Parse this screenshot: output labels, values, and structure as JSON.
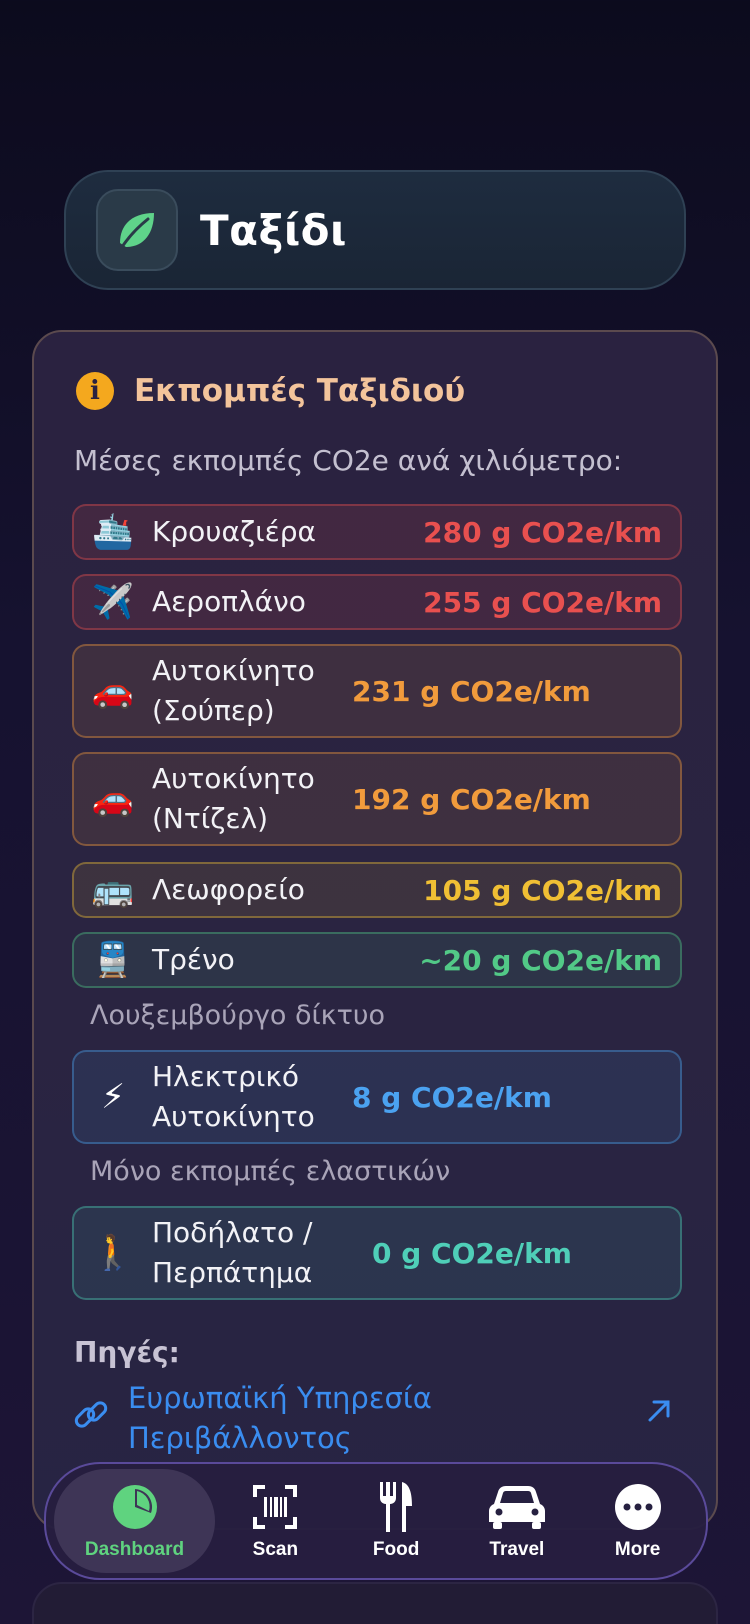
{
  "header": {
    "title": "Ταξίδι",
    "icon": "leaf-icon"
  },
  "card": {
    "title": "Εκπομπές Ταξιδιού",
    "subtitle": "Μέσες εκπομπές CO2e ανά χιλιόμετρο:",
    "rows": [
      {
        "emoji": "🛳️",
        "label": "Κρουαζιέρα",
        "value": "280 g CO2e/km",
        "color": "#e8504f"
      },
      {
        "emoji": "✈️",
        "label": "Αεροπλάνο",
        "value": "255 g CO2e/km",
        "color": "#e8504f"
      },
      {
        "emoji": "🚗",
        "label": "Αυτοκίνητο (Σούπερ)",
        "value": "231 g CO2e/km",
        "color": "#f19b3c"
      },
      {
        "emoji": "🚗",
        "label": "Αυτοκίνητο (Ντίζελ)",
        "value": "192 g CO2e/km",
        "color": "#f19b3c"
      },
      {
        "emoji": "🚌",
        "label": "Λεωφορείο",
        "value": "105 g CO2e/km",
        "color": "#f0bf34"
      },
      {
        "emoji": "🚆",
        "label": "Τρένο",
        "value": "~20 g CO2e/km",
        "color": "#52c987"
      },
      {
        "emoji": "⚡",
        "label": "Ηλεκτρικό Αυτοκίνητο",
        "value": "8 g CO2e/km",
        "color": "#4ba2f0"
      },
      {
        "emoji": "🚶",
        "label": "Ποδήλατο / Περπάτημα",
        "value": "0 g CO2e/km",
        "color": "#4fcfb8"
      }
    ],
    "notes": {
      "train": "Λουξεμβούργο δίκτυο",
      "ev": "Μόνο εκπομπές ελαστικών"
    },
    "sources_label": "Πηγές:",
    "source_link": "Ευρωπαϊκή Υπηρεσία Περιβάλλοντος"
  },
  "tabs": [
    {
      "label": "Dashboard",
      "icon": "pie-chart-icon",
      "active": true
    },
    {
      "label": "Scan",
      "icon": "barcode-scan-icon",
      "active": false
    },
    {
      "label": "Food",
      "icon": "fork-knife-icon",
      "active": false
    },
    {
      "label": "Travel",
      "icon": "car-icon",
      "active": false
    },
    {
      "label": "More",
      "icon": "more-dots-icon",
      "active": false
    }
  ],
  "colors": {
    "accent_green": "#5fd37f",
    "title_peach": "#f3c49b",
    "link_blue": "#3a8df0",
    "info_orange": "#f4a81e"
  }
}
